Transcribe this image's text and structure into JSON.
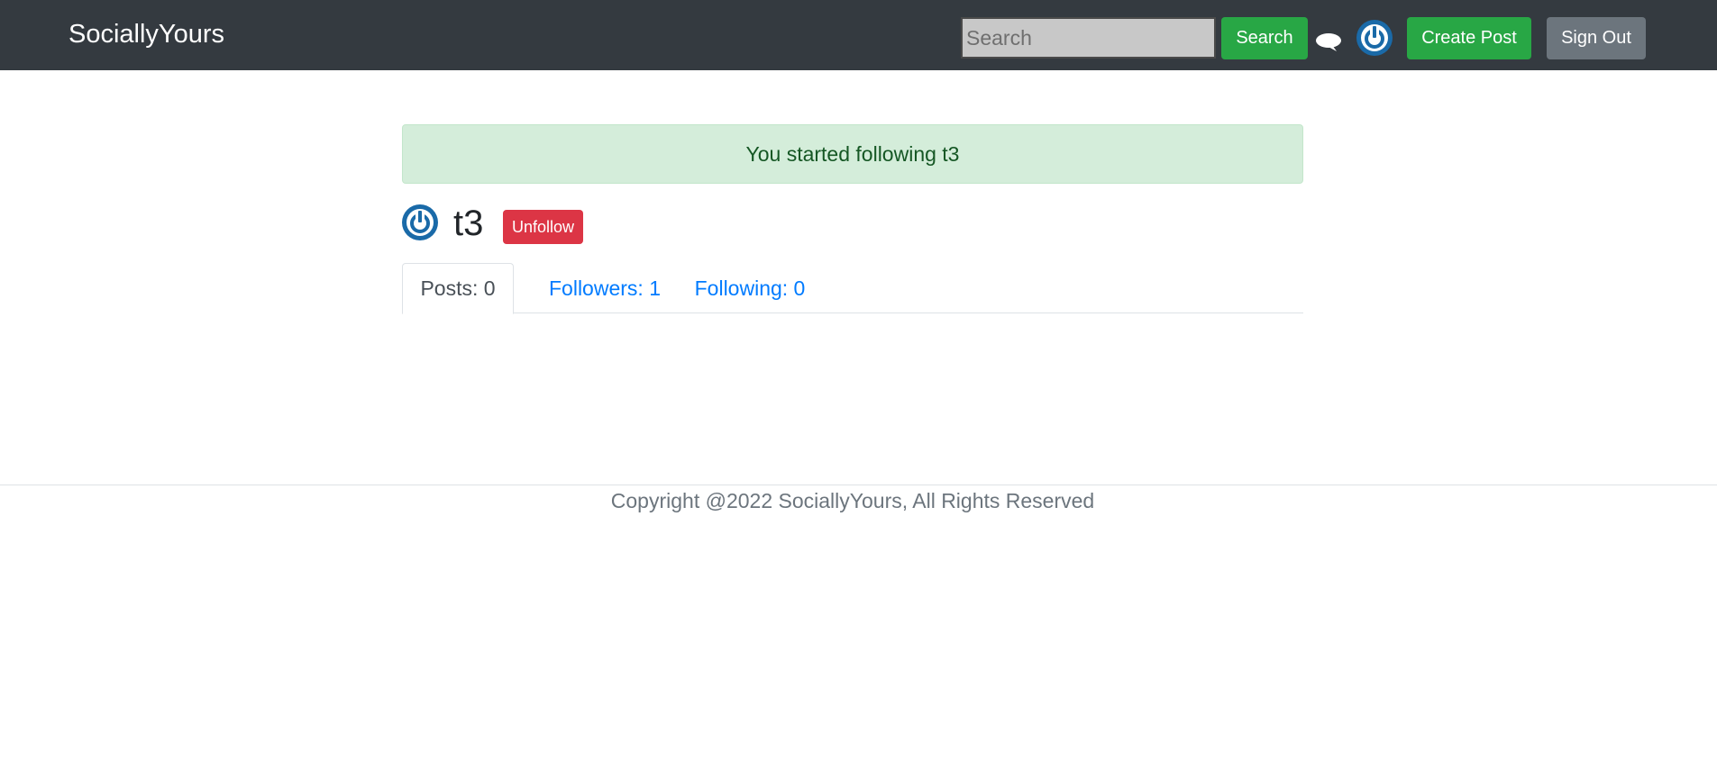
{
  "navbar": {
    "brand": "SociallyYours",
    "search_placeholder": "Search",
    "search_value": "",
    "search_button": "Search",
    "chat_icon": "chat-bubble-icon",
    "avatar_icon": "power-avatar-icon",
    "create_post": "Create Post",
    "sign_out": "Sign Out"
  },
  "alert": {
    "message": "You started following t3"
  },
  "profile": {
    "avatar_icon": "power-avatar-icon",
    "username": "t3",
    "unfollow_button": "Unfollow"
  },
  "tabs": [
    {
      "label": "Posts: 0",
      "active": true
    },
    {
      "label": "Followers: 1",
      "active": false
    },
    {
      "label": "Following: 0",
      "active": false
    }
  ],
  "footer": {
    "text": "Copyright @2022 SociallyYours, All Rights Reserved"
  },
  "colors": {
    "navbar": "#343a40",
    "success": "#28a745",
    "secondary": "#6c757d",
    "danger": "#dc3545",
    "link": "#007bff",
    "avatar": "#1a6aa8"
  }
}
